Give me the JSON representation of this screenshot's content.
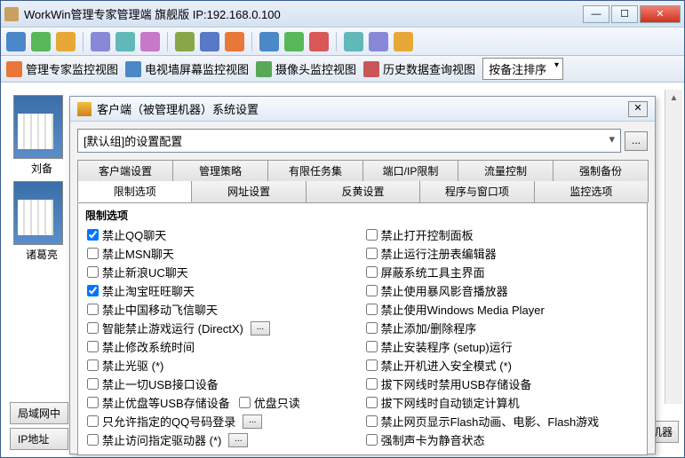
{
  "main": {
    "title": "WorkWin管理专家管理端   旗舰版 IP:192.168.0.100",
    "toolbar2": {
      "view1": "管理专家监控视图",
      "view2": "电视墙屏幕监控视图",
      "view3": "摄像头监控视图",
      "view4": "历史数据查询视图",
      "sort": "按备注排序"
    },
    "thumbs": {
      "u1": "刘备",
      "u2": "诸葛亮"
    },
    "bottom": {
      "b1": "局域网中",
      "b2": "IP地址"
    },
    "rightbtn": "监视机器"
  },
  "dialog": {
    "title": "客户端（被管理机器）系统设置",
    "config_sel": "[默认组]的设置配置",
    "tabs_row1": [
      "客户端设置",
      "管理策略",
      "有限任务集",
      "端口/IP限制",
      "流量控制",
      "强制备份"
    ],
    "tabs_row2": [
      "限制选项",
      "网址设置",
      "反黄设置",
      "程序与窗口项",
      "监控选项"
    ],
    "panel_title": "限制选项",
    "left_opts": [
      {
        "label": "禁止QQ聊天",
        "checked": true
      },
      {
        "label": "禁止MSN聊天",
        "checked": false
      },
      {
        "label": "禁止新浪UC聊天",
        "checked": false
      },
      {
        "label": "禁止淘宝旺旺聊天",
        "checked": true
      },
      {
        "label": "禁止中国移动飞信聊天",
        "checked": false
      },
      {
        "label": "智能禁止游戏运行 (DirectX)",
        "checked": false,
        "btn": true
      },
      {
        "label": "禁止修改系统时间",
        "checked": false
      },
      {
        "label": "禁止光驱 (*)",
        "checked": false
      },
      {
        "label": "禁止一切USB接口设备",
        "checked": false
      },
      {
        "label": "禁止优盘等USB存储设备",
        "checked": false,
        "extra": "优盘只读"
      },
      {
        "label": "只允许指定的QQ号码登录",
        "checked": false,
        "btn": true
      },
      {
        "label": "禁止访问指定驱动器 (*)",
        "checked": false,
        "btn": true
      }
    ],
    "right_opts": [
      {
        "label": "禁止打开控制面板",
        "checked": false
      },
      {
        "label": "禁止运行注册表编辑器",
        "checked": false
      },
      {
        "label": "屏蔽系统工具主界面",
        "checked": false
      },
      {
        "label": "禁止使用暴风影音播放器",
        "checked": false
      },
      {
        "label": "禁止使用Windows Media Player",
        "checked": false
      },
      {
        "label": "禁止添加/删除程序",
        "checked": false
      },
      {
        "label": "禁止安装程序 (setup)运行",
        "checked": false
      },
      {
        "label": "禁止开机进入安全模式 (*)",
        "checked": false
      },
      {
        "label": "拔下网线时禁用USB存储设备",
        "checked": false
      },
      {
        "label": "拔下网线时自动锁定计算机",
        "checked": false
      },
      {
        "label": "禁止网页显示Flash动画、电影、Flash游戏",
        "checked": false
      },
      {
        "label": "强制声卡为静音状态",
        "checked": false
      }
    ]
  },
  "colors": {
    "ic1": "#4a88c8",
    "ic2": "#58b858",
    "ic3": "#e8a838",
    "ic4": "#d85858",
    "ic5": "#8888d8",
    "ic6": "#60b8b8",
    "ic7": "#c878c8",
    "ic8": "#88a848",
    "ic9": "#5878c8",
    "ic10": "#e87838",
    "v1": "#e87838",
    "v2": "#4a88c8",
    "v3": "#58a858",
    "v4": "#c85858"
  }
}
